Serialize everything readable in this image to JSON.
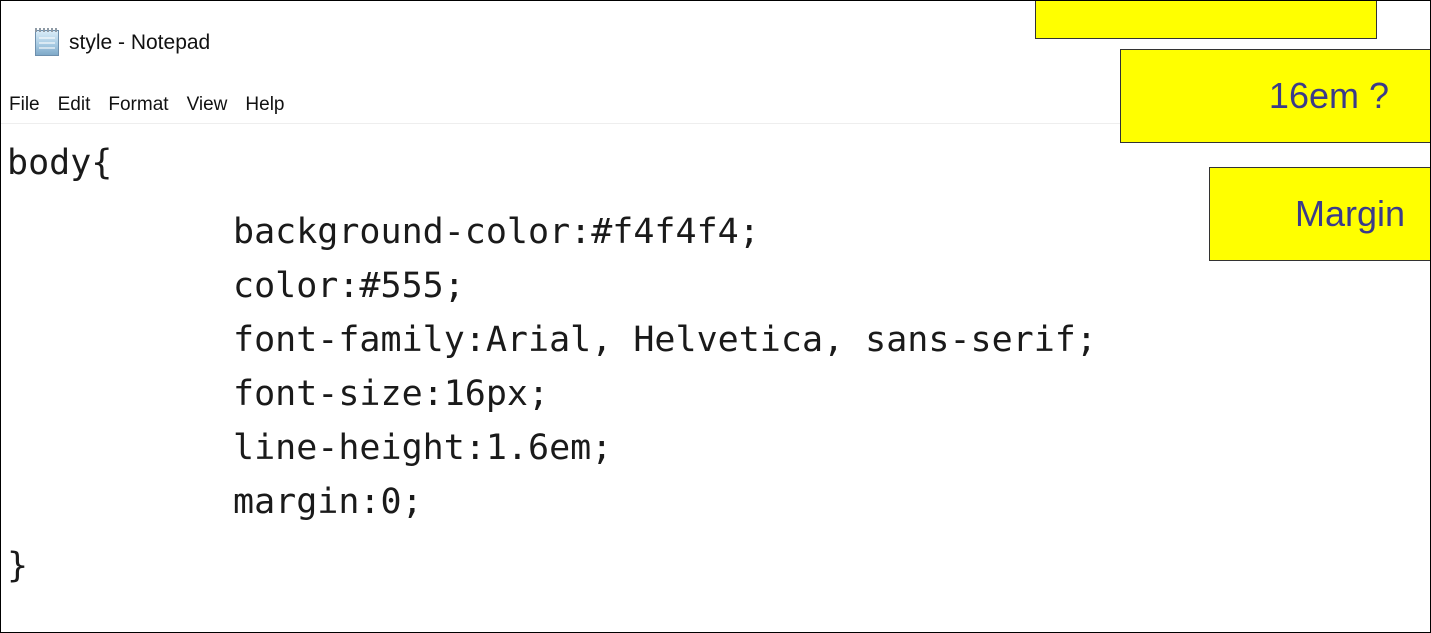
{
  "window": {
    "title": "style - Notepad",
    "icon": "notepad-icon"
  },
  "menu": [
    "File",
    "Edit",
    "Format",
    "View",
    "Help"
  ],
  "code": [
    "body{",
    "background-color:#f4f4f4;",
    "color:#555;",
    "font-family:Arial, Helvetica, sans-serif;",
    "font-size:16px;",
    "line-height:1.6em;",
    "margin:0;",
    "}"
  ],
  "notes": {
    "top": "",
    "middle": "16em ?",
    "bottom": "Margin"
  },
  "colors": {
    "note_background": "#ffff00",
    "note_text": "#3b3b8a"
  }
}
